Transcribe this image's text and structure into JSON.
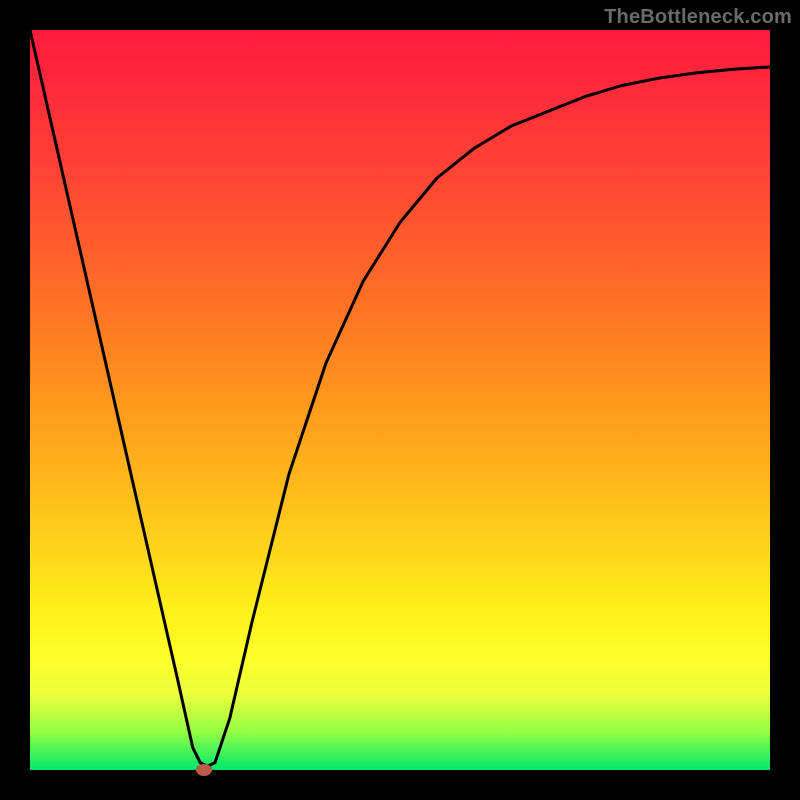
{
  "watermark": "TheBottleneck.com",
  "colors": {
    "background": "#000000",
    "gradient_top": "#ff1a3c",
    "gradient_mid1": "#ff7a22",
    "gradient_mid2": "#ffd41a",
    "gradient_bottom": "#00e86a",
    "curve": "#000000",
    "marker": "#bb5b4a",
    "watermark_text": "#6a6a6a"
  },
  "chart_data": {
    "type": "line",
    "title": "",
    "xlabel": "",
    "ylabel": "",
    "xlim": [
      0,
      100
    ],
    "ylim": [
      0,
      100
    ],
    "grid": false,
    "legend_position": "none",
    "series": [
      {
        "name": "curve",
        "x": [
          0,
          5,
          10,
          15,
          20,
          22,
          23,
          24,
          25,
          27,
          30,
          35,
          40,
          45,
          50,
          55,
          60,
          65,
          70,
          75,
          80,
          85,
          90,
          95,
          100
        ],
        "values": [
          100,
          78,
          56,
          34,
          12,
          3,
          1,
          0.5,
          1,
          7,
          20,
          40,
          55,
          66,
          74,
          80,
          84,
          87,
          89,
          91,
          92.5,
          93.5,
          94.2,
          94.7,
          95
        ]
      }
    ],
    "annotations": [
      {
        "type": "marker",
        "x": 23.5,
        "y": 0,
        "label": "minimum-point"
      }
    ]
  }
}
